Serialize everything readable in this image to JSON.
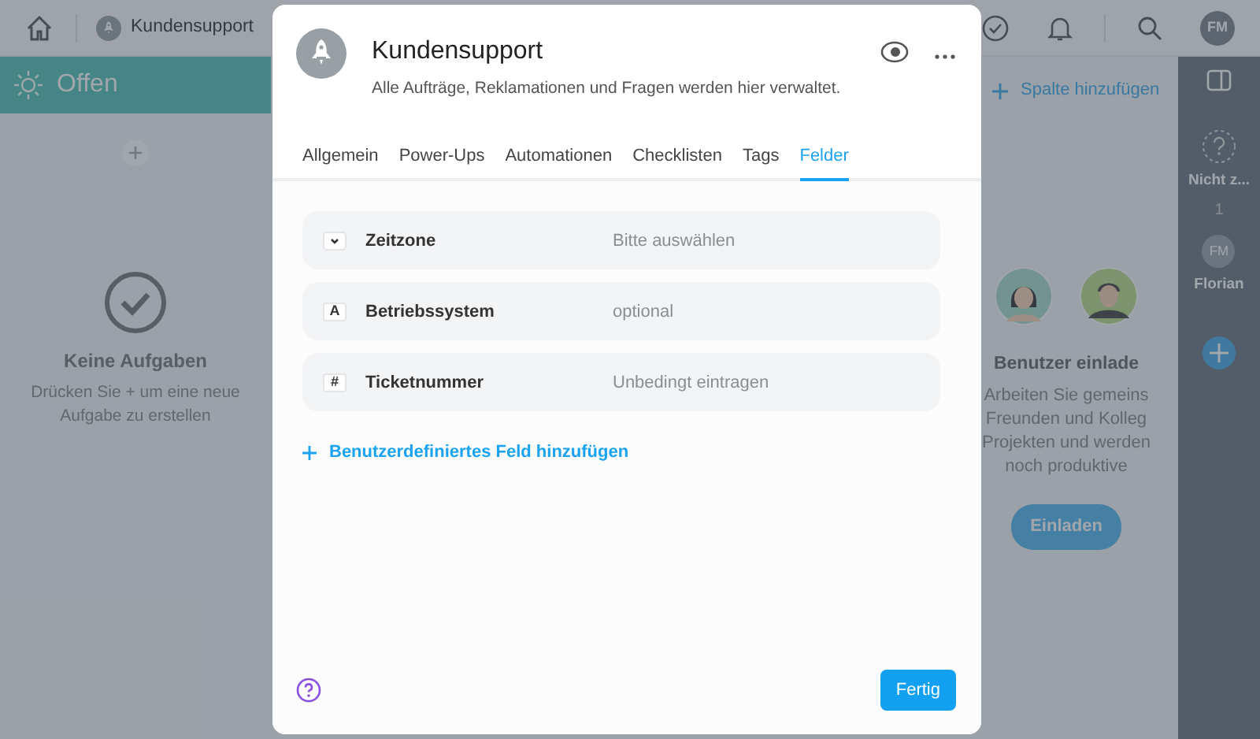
{
  "topbar": {
    "project_title": "Kundensupport",
    "user_initials": "FM"
  },
  "column": {
    "title": "Offen",
    "empty_title": "Keine Aufgaben",
    "empty_text": "Drücken Sie + um eine neue Aufgabe zu erstellen"
  },
  "add_column": "Spalte hinzufügen",
  "invite": {
    "title": "Benutzer einlade",
    "lines": [
      "Arbeiten Sie gemeins",
      "Freunden und Kolleg",
      "Projekten und werden",
      "noch produktive"
    ],
    "button": "Einladen"
  },
  "members_panel": {
    "items": [
      {
        "kind": "unassigned",
        "label": "Nicht z...",
        "count": "1"
      },
      {
        "kind": "user",
        "initials": "FM",
        "label": "Florian"
      }
    ]
  },
  "dialog": {
    "title": "Kundensupport",
    "description": "Alle Aufträge, Reklamationen und Fragen werden hier verwaltet.",
    "tabs": [
      {
        "label": "Allgemein",
        "selected": false
      },
      {
        "label": "Power-Ups",
        "selected": false
      },
      {
        "label": "Automationen",
        "selected": false
      },
      {
        "label": "Checklisten",
        "selected": false
      },
      {
        "label": "Tags",
        "selected": false
      },
      {
        "label": "Felder",
        "selected": true
      }
    ],
    "fields": [
      {
        "kind": "select",
        "name": "Zeitzone",
        "placeholder": "Bitte auswählen"
      },
      {
        "kind": "text",
        "symbol": "A",
        "name": "Betriebssystem",
        "placeholder": "optional"
      },
      {
        "kind": "number",
        "symbol": "#",
        "name": "Ticketnummer",
        "placeholder": "Unbedingt eintragen"
      }
    ],
    "add_field": "Benutzerdefiniertes Feld hinzufügen",
    "done_button": "Fertig"
  }
}
